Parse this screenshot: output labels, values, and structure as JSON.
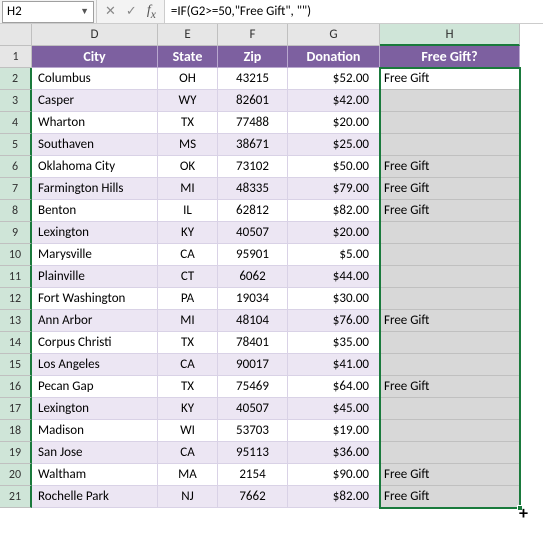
{
  "formula_bar": {
    "name_box": "H2",
    "formula": "=IF(G2>=50,\"Free Gift\", \"\")"
  },
  "columns": [
    "D",
    "E",
    "F",
    "G",
    "H"
  ],
  "headers": {
    "city": "City",
    "state": "State",
    "zip": "Zip",
    "donation": "Donation",
    "gift": "Free Gift?"
  },
  "row_labels": [
    "1",
    "2",
    "3",
    "4",
    "5",
    "6",
    "7",
    "8",
    "9",
    "10",
    "11",
    "12",
    "13",
    "14",
    "15",
    "16",
    "17",
    "18",
    "19",
    "20",
    "21"
  ],
  "rows": [
    {
      "city": "Columbus",
      "state": "OH",
      "zip": "43215",
      "donation": "$52.00",
      "gift": "Free Gift"
    },
    {
      "city": "Casper",
      "state": "WY",
      "zip": "82601",
      "donation": "$42.00",
      "gift": ""
    },
    {
      "city": "Wharton",
      "state": "TX",
      "zip": "77488",
      "donation": "$20.00",
      "gift": ""
    },
    {
      "city": "Southaven",
      "state": "MS",
      "zip": "38671",
      "donation": "$25.00",
      "gift": ""
    },
    {
      "city": "Oklahoma City",
      "state": "OK",
      "zip": "73102",
      "donation": "$50.00",
      "gift": "Free Gift"
    },
    {
      "city": "Farmington Hills",
      "state": "MI",
      "zip": "48335",
      "donation": "$79.00",
      "gift": "Free Gift"
    },
    {
      "city": "Benton",
      "state": "IL",
      "zip": "62812",
      "donation": "$82.00",
      "gift": "Free Gift"
    },
    {
      "city": "Lexington",
      "state": "KY",
      "zip": "40507",
      "donation": "$20.00",
      "gift": ""
    },
    {
      "city": "Marysville",
      "state": "CA",
      "zip": "95901",
      "donation": "$5.00",
      "gift": ""
    },
    {
      "city": "Plainville",
      "state": "CT",
      "zip": "6062",
      "donation": "$44.00",
      "gift": ""
    },
    {
      "city": "Fort Washington",
      "state": "PA",
      "zip": "19034",
      "donation": "$30.00",
      "gift": ""
    },
    {
      "city": "Ann Arbor",
      "state": "MI",
      "zip": "48104",
      "donation": "$76.00",
      "gift": "Free Gift"
    },
    {
      "city": "Corpus Christi",
      "state": "TX",
      "zip": "78401",
      "donation": "$35.00",
      "gift": ""
    },
    {
      "city": "Los Angeles",
      "state": "CA",
      "zip": "90017",
      "donation": "$41.00",
      "gift": ""
    },
    {
      "city": "Pecan Gap",
      "state": "TX",
      "zip": "75469",
      "donation": "$64.00",
      "gift": "Free Gift"
    },
    {
      "city": "Lexington",
      "state": "KY",
      "zip": "40507",
      "donation": "$45.00",
      "gift": ""
    },
    {
      "city": "Madison",
      "state": "WI",
      "zip": "53703",
      "donation": "$19.00",
      "gift": ""
    },
    {
      "city": "San Jose",
      "state": "CA",
      "zip": "95113",
      "donation": "$36.00",
      "gift": ""
    },
    {
      "city": "Waltham",
      "state": "MA",
      "zip": "2154",
      "donation": "$90.00",
      "gift": "Free Gift"
    },
    {
      "city": "Rochelle Park",
      "state": "NJ",
      "zip": "7662",
      "donation": "$82.00",
      "gift": "Free Gift"
    }
  ]
}
